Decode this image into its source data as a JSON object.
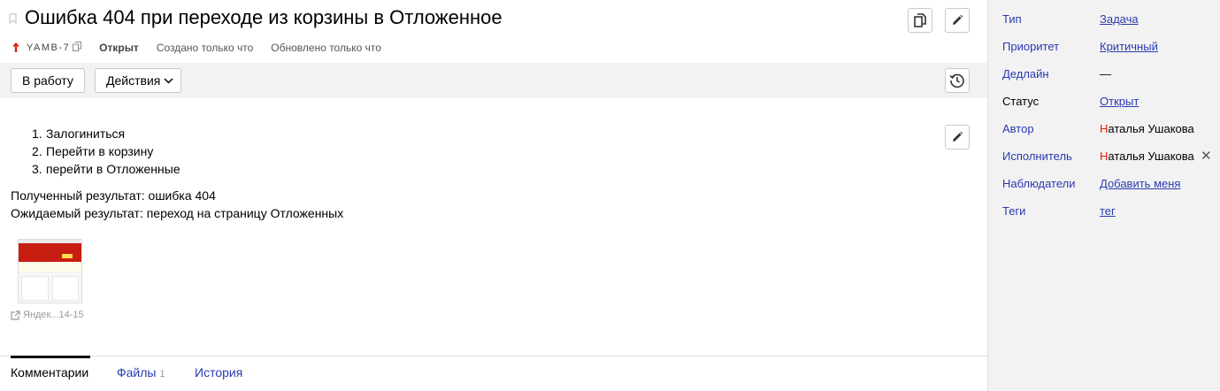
{
  "issue": {
    "title": "Ошибка 404 при переходе из корзины в Отложенное",
    "key": "YAMB-7",
    "priority_icon": "arrow-up-icon",
    "priority_color": "#e0210b",
    "status": "Открыт",
    "created": "Создано только что",
    "updated": "Обновлено только что"
  },
  "toolbar": {
    "work_label": "В работу",
    "actions_label": "Действия"
  },
  "description": {
    "steps": [
      {
        "num": "1.",
        "text": "Залогиниться"
      },
      {
        "num": "2.",
        "text": "Перейти в корзину"
      },
      {
        "num": "3.",
        "text": "перейти в Отложенные"
      }
    ],
    "actual": "Полученный результат: ошибка 404",
    "expected": "Ожидаемый результат: переход на страницу Отложенных"
  },
  "attachment": {
    "label": "Яндек...14-15"
  },
  "tabs": {
    "comments": "Комментарии",
    "files": "Файлы",
    "files_count": "1",
    "history": "История"
  },
  "sidebar": {
    "type_label": "Тип",
    "type_value": "Задача",
    "priority_label": "Приоритет",
    "priority_value": "Критичный",
    "deadline_label": "Дедлайн",
    "deadline_value": "—",
    "status_label": "Статус",
    "status_value": "Открыт",
    "author_label": "Автор",
    "author_first": "Н",
    "author_rest": "аталья Ушакова",
    "assignee_label": "Исполнитель",
    "assignee_first": "Н",
    "assignee_rest": "аталья Ушакова",
    "watchers_label": "Наблюдатели",
    "watchers_value": "Добавить меня",
    "tags_label": "Теги",
    "tags_value": "тег"
  },
  "colors": {
    "link": "#2a3bb0",
    "toolbar_bg": "#f2f2f2",
    "sidebar_bg": "#f2f2f2",
    "accent_red": "#e0210b"
  }
}
